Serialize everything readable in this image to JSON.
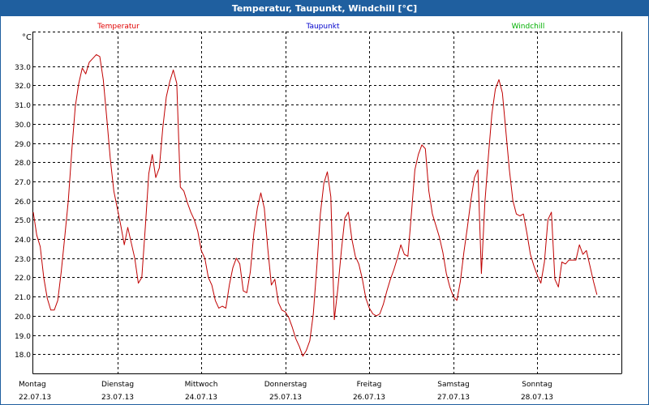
{
  "window": {
    "title": "Temperatur, Taupunkt, Windchill [°C]"
  },
  "chart_data": {
    "type": "line",
    "title": "Temperatur, Taupunkt, Windchill [°C]",
    "ylabel": "°C",
    "ylim": [
      17.0,
      34.8
    ],
    "xlim": [
      0,
      168
    ],
    "yticks": [
      18.0,
      19.0,
      20.0,
      21.0,
      22.0,
      23.0,
      24.0,
      25.0,
      26.0,
      27.0,
      28.0,
      29.0,
      30.0,
      31.0,
      32.0,
      33.0
    ],
    "grid": true,
    "legend": [
      {
        "name": "Temperatur",
        "color": "#e00000"
      },
      {
        "name": "Taupunkt",
        "color": "#0000cc"
      },
      {
        "name": "Windchill",
        "color": "#00b000"
      }
    ],
    "x_labels": [
      {
        "at": 0,
        "day": "Montag",
        "date": "22.07.13"
      },
      {
        "at": 24,
        "day": "Dienstag",
        "date": "23.07.13"
      },
      {
        "at": 48,
        "day": "Mittwoch",
        "date": "24.07.13"
      },
      {
        "at": 72,
        "day": "Donnerstag",
        "date": "25.07.13"
      },
      {
        "at": 96,
        "day": "Freitag",
        "date": "26.07.13"
      },
      {
        "at": 120,
        "day": "Samstag",
        "date": "27.07.13"
      },
      {
        "at": 144,
        "day": "Sonntag",
        "date": "28.07.13"
      }
    ],
    "series": [
      {
        "name": "Temperatur",
        "color": "#c00000",
        "points": [
          [
            0,
            25.4
          ],
          [
            1,
            24.2
          ],
          [
            2,
            23.6
          ],
          [
            3,
            22.0
          ],
          [
            4,
            20.9
          ],
          [
            5,
            20.3
          ],
          [
            6,
            20.3
          ],
          [
            7,
            20.8
          ],
          [
            8,
            22.3
          ],
          [
            9,
            24.1
          ],
          [
            10,
            26.0
          ],
          [
            11,
            28.6
          ],
          [
            12,
            30.9
          ],
          [
            13,
            32.1
          ],
          [
            14,
            32.9
          ],
          [
            15,
            32.6
          ],
          [
            16,
            33.2
          ],
          [
            17,
            33.4
          ],
          [
            18,
            33.6
          ],
          [
            19,
            33.5
          ],
          [
            20,
            32.3
          ],
          [
            21,
            30.3
          ],
          [
            22,
            28.2
          ],
          [
            23,
            26.5
          ],
          [
            24,
            25.6
          ],
          [
            25,
            24.7
          ],
          [
            26,
            23.7
          ],
          [
            27,
            24.6
          ],
          [
            28,
            23.8
          ],
          [
            29,
            23.0
          ],
          [
            30,
            21.7
          ],
          [
            31,
            22.0
          ],
          [
            32,
            24.6
          ],
          [
            33,
            27.4
          ],
          [
            34,
            28.4
          ],
          [
            35,
            27.2
          ],
          [
            36,
            27.7
          ],
          [
            37,
            29.8
          ],
          [
            38,
            31.4
          ],
          [
            39,
            32.2
          ],
          [
            40,
            32.8
          ],
          [
            41,
            32.1
          ],
          [
            42,
            26.7
          ],
          [
            43,
            26.5
          ],
          [
            44,
            25.9
          ],
          [
            45,
            25.4
          ],
          [
            46,
            25.0
          ],
          [
            47,
            24.4
          ],
          [
            48,
            23.4
          ],
          [
            49,
            23.0
          ],
          [
            50,
            22.0
          ],
          [
            51,
            21.6
          ],
          [
            52,
            20.8
          ],
          [
            53,
            20.4
          ],
          [
            54,
            20.5
          ],
          [
            55,
            20.4
          ],
          [
            56,
            21.6
          ],
          [
            57,
            22.5
          ],
          [
            58,
            23.0
          ],
          [
            59,
            22.7
          ],
          [
            60,
            21.3
          ],
          [
            61,
            21.2
          ],
          [
            62,
            22.3
          ],
          [
            63,
            24.3
          ],
          [
            64,
            25.6
          ],
          [
            65,
            26.4
          ],
          [
            66,
            25.6
          ],
          [
            67,
            23.5
          ],
          [
            68,
            21.6
          ],
          [
            69,
            21.9
          ],
          [
            70,
            20.7
          ],
          [
            71,
            20.3
          ],
          [
            72,
            20.2
          ],
          [
            73,
            19.9
          ],
          [
            74,
            19.4
          ],
          [
            75,
            18.8
          ],
          [
            76,
            18.4
          ],
          [
            77,
            17.9
          ],
          [
            78,
            18.2
          ],
          [
            79,
            18.7
          ],
          [
            80,
            20.1
          ],
          [
            81,
            22.6
          ],
          [
            82,
            25.3
          ],
          [
            83,
            26.9
          ],
          [
            84,
            27.5
          ],
          [
            85,
            26.2
          ],
          [
            86,
            19.8
          ],
          [
            87,
            21.4
          ],
          [
            88,
            23.4
          ],
          [
            89,
            25.1
          ],
          [
            90,
            25.4
          ],
          [
            91,
            24.0
          ],
          [
            92,
            23.1
          ],
          [
            93,
            22.7
          ],
          [
            94,
            21.9
          ],
          [
            95,
            20.9
          ],
          [
            96,
            20.4
          ],
          [
            97,
            20.1
          ],
          [
            98,
            20.0
          ],
          [
            99,
            20.1
          ],
          [
            100,
            20.6
          ],
          [
            101,
            21.3
          ],
          [
            102,
            21.9
          ],
          [
            103,
            22.4
          ],
          [
            104,
            23.0
          ],
          [
            105,
            23.7
          ],
          [
            106,
            23.2
          ],
          [
            107,
            23.1
          ],
          [
            108,
            25.3
          ],
          [
            109,
            27.6
          ],
          [
            110,
            28.4
          ],
          [
            111,
            28.9
          ],
          [
            112,
            28.7
          ],
          [
            113,
            26.5
          ],
          [
            114,
            25.3
          ],
          [
            115,
            24.7
          ],
          [
            116,
            24.1
          ],
          [
            117,
            23.3
          ],
          [
            118,
            22.2
          ],
          [
            119,
            21.5
          ],
          [
            120,
            21.0
          ],
          [
            121,
            20.8
          ],
          [
            122,
            21.8
          ],
          [
            123,
            23.3
          ],
          [
            124,
            24.6
          ],
          [
            125,
            26.0
          ],
          [
            126,
            27.2
          ],
          [
            127,
            27.6
          ],
          [
            128,
            22.2
          ],
          [
            129,
            25.9
          ],
          [
            130,
            28.3
          ],
          [
            131,
            30.5
          ],
          [
            132,
            31.8
          ],
          [
            133,
            32.3
          ],
          [
            134,
            31.6
          ],
          [
            135,
            29.6
          ],
          [
            136,
            27.6
          ],
          [
            137,
            26.0
          ],
          [
            138,
            25.3
          ],
          [
            139,
            25.2
          ],
          [
            140,
            25.3
          ],
          [
            141,
            24.3
          ],
          [
            142,
            23.2
          ],
          [
            143,
            22.6
          ],
          [
            144,
            22.1
          ],
          [
            145,
            21.7
          ],
          [
            146,
            22.8
          ],
          [
            147,
            25.0
          ],
          [
            148,
            25.4
          ],
          [
            149,
            21.9
          ],
          [
            150,
            21.5
          ],
          [
            151,
            22.8
          ],
          [
            152,
            22.7
          ],
          [
            153,
            22.9
          ],
          [
            154,
            22.9
          ],
          [
            155,
            22.9
          ],
          [
            156,
            23.7
          ],
          [
            157,
            23.2
          ],
          [
            158,
            23.4
          ],
          [
            159,
            22.6
          ],
          [
            160,
            21.8
          ],
          [
            161,
            21.1
          ]
        ]
      }
    ]
  }
}
